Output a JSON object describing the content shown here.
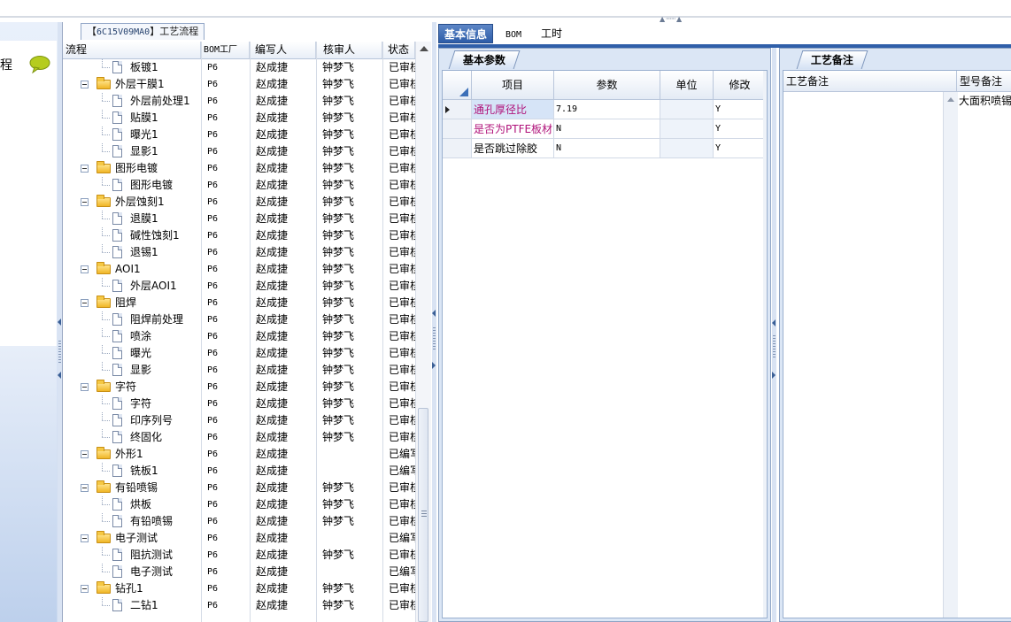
{
  "sidebar": {
    "title_fragment": "程"
  },
  "tree_panel": {
    "tab_prefix": "【",
    "tab_code": "6C15V09MA0",
    "tab_suffix": "】工艺流程",
    "columns": [
      "流程",
      "BOM工厂",
      "编写人",
      "核审人",
      "状态"
    ],
    "rows": [
      {
        "level": 2,
        "type": "doc",
        "name": "板镀1",
        "factory": "P6",
        "author": "赵成捷",
        "reviewer": "钟梦飞",
        "status": "已审核"
      },
      {
        "level": 1,
        "type": "folder",
        "name": "外层干膜1",
        "factory": "P6",
        "author": "赵成捷",
        "reviewer": "钟梦飞",
        "status": "已审核"
      },
      {
        "level": 2,
        "type": "doc",
        "name": "外层前处理1",
        "factory": "P6",
        "author": "赵成捷",
        "reviewer": "钟梦飞",
        "status": "已审核"
      },
      {
        "level": 2,
        "type": "doc",
        "name": "贴膜1",
        "factory": "P6",
        "author": "赵成捷",
        "reviewer": "钟梦飞",
        "status": "已审核"
      },
      {
        "level": 2,
        "type": "doc",
        "name": "曝光1",
        "factory": "P6",
        "author": "赵成捷",
        "reviewer": "钟梦飞",
        "status": "已审核"
      },
      {
        "level": 2,
        "type": "doc",
        "name": "显影1",
        "factory": "P6",
        "author": "赵成捷",
        "reviewer": "钟梦飞",
        "status": "已审核"
      },
      {
        "level": 1,
        "type": "folder",
        "name": "图形电镀",
        "factory": "P6",
        "author": "赵成捷",
        "reviewer": "钟梦飞",
        "status": "已审核"
      },
      {
        "level": 2,
        "type": "doc",
        "name": "图形电镀",
        "factory": "P6",
        "author": "赵成捷",
        "reviewer": "钟梦飞",
        "status": "已审核"
      },
      {
        "level": 1,
        "type": "folder",
        "name": "外层蚀刻1",
        "factory": "P6",
        "author": "赵成捷",
        "reviewer": "钟梦飞",
        "status": "已审核"
      },
      {
        "level": 2,
        "type": "doc",
        "name": "退膜1",
        "factory": "P6",
        "author": "赵成捷",
        "reviewer": "钟梦飞",
        "status": "已审核"
      },
      {
        "level": 2,
        "type": "doc",
        "name": "碱性蚀刻1",
        "factory": "P6",
        "author": "赵成捷",
        "reviewer": "钟梦飞",
        "status": "已审核"
      },
      {
        "level": 2,
        "type": "doc",
        "name": "退锡1",
        "factory": "P6",
        "author": "赵成捷",
        "reviewer": "钟梦飞",
        "status": "已审核"
      },
      {
        "level": 1,
        "type": "folder",
        "name": "AOI1",
        "factory": "P6",
        "author": "赵成捷",
        "reviewer": "钟梦飞",
        "status": "已审核"
      },
      {
        "level": 2,
        "type": "doc",
        "name": "外层AOI1",
        "factory": "P6",
        "author": "赵成捷",
        "reviewer": "钟梦飞",
        "status": "已审核"
      },
      {
        "level": 1,
        "type": "folder",
        "name": "阻焊",
        "factory": "P6",
        "author": "赵成捷",
        "reviewer": "钟梦飞",
        "status": "已审核"
      },
      {
        "level": 2,
        "type": "doc",
        "name": "阻焊前处理",
        "factory": "P6",
        "author": "赵成捷",
        "reviewer": "钟梦飞",
        "status": "已审核"
      },
      {
        "level": 2,
        "type": "doc",
        "name": "喷涂",
        "factory": "P6",
        "author": "赵成捷",
        "reviewer": "钟梦飞",
        "status": "已审核"
      },
      {
        "level": 2,
        "type": "doc",
        "name": "曝光",
        "factory": "P6",
        "author": "赵成捷",
        "reviewer": "钟梦飞",
        "status": "已审核"
      },
      {
        "level": 2,
        "type": "doc",
        "name": "显影",
        "factory": "P6",
        "author": "赵成捷",
        "reviewer": "钟梦飞",
        "status": "已审核"
      },
      {
        "level": 1,
        "type": "folder",
        "name": "字符",
        "factory": "P6",
        "author": "赵成捷",
        "reviewer": "钟梦飞",
        "status": "已审核"
      },
      {
        "level": 2,
        "type": "doc",
        "name": "字符",
        "factory": "P6",
        "author": "赵成捷",
        "reviewer": "钟梦飞",
        "status": "已审核"
      },
      {
        "level": 2,
        "type": "doc",
        "name": "印序列号",
        "factory": "P6",
        "author": "赵成捷",
        "reviewer": "钟梦飞",
        "status": "已审核"
      },
      {
        "level": 2,
        "type": "doc",
        "name": "终固化",
        "factory": "P6",
        "author": "赵成捷",
        "reviewer": "钟梦飞",
        "status": "已审核"
      },
      {
        "level": 1,
        "type": "folder",
        "name": "外形1",
        "factory": "P6",
        "author": "赵成捷",
        "reviewer": "",
        "status": "已编写"
      },
      {
        "level": 2,
        "type": "doc",
        "name": "铣板1",
        "factory": "P6",
        "author": "赵成捷",
        "reviewer": "",
        "status": "已编写"
      },
      {
        "level": 1,
        "type": "folder",
        "name": "有铅喷锡",
        "factory": "P6",
        "author": "赵成捷",
        "reviewer": "钟梦飞",
        "status": "已审核"
      },
      {
        "level": 2,
        "type": "doc",
        "name": "烘板",
        "factory": "P6",
        "author": "赵成捷",
        "reviewer": "钟梦飞",
        "status": "已审核"
      },
      {
        "level": 2,
        "type": "doc",
        "name": "有铅喷锡",
        "factory": "P6",
        "author": "赵成捷",
        "reviewer": "钟梦飞",
        "status": "已审核"
      },
      {
        "level": 1,
        "type": "folder",
        "name": "电子测试",
        "factory": "P6",
        "author": "赵成捷",
        "reviewer": "",
        "status": "已编写"
      },
      {
        "level": 2,
        "type": "doc",
        "name": "阻抗测试",
        "factory": "P6",
        "author": "赵成捷",
        "reviewer": "钟梦飞",
        "status": "已审核"
      },
      {
        "level": 2,
        "type": "doc",
        "name": "电子测试",
        "factory": "P6",
        "author": "赵成捷",
        "reviewer": "",
        "status": "已编写"
      },
      {
        "level": 1,
        "type": "folder",
        "name": "钻孔1",
        "factory": "P6",
        "author": "赵成捷",
        "reviewer": "钟梦飞",
        "status": "已审核"
      },
      {
        "level": 2,
        "type": "doc",
        "name": "二钻1",
        "factory": "P6",
        "author": "赵成捷",
        "reviewer": "钟梦飞",
        "status": "已审核"
      }
    ]
  },
  "right": {
    "tabs": [
      "基本信息",
      "BOM",
      "工时"
    ],
    "params": {
      "subtab": "基本参数",
      "columns": [
        "项目",
        "参数",
        "单位",
        "修改"
      ],
      "rows": [
        {
          "item": "通孔厚径比",
          "value": "7.19",
          "unit": "",
          "modify": "Y",
          "item_color": "#b0127a"
        },
        {
          "item": "是否为PTFE板材",
          "value": "N",
          "unit": "",
          "modify": "Y",
          "item_color": "#b0127a"
        },
        {
          "item": "是否跳过除胶",
          "value": "N",
          "unit": "",
          "modify": "Y",
          "item_color": "#000000"
        }
      ]
    },
    "notes": {
      "subtab": "工艺备注",
      "columns": [
        "工艺备注",
        "型号备注"
      ],
      "model_note": "大面积喷锡,"
    }
  },
  "colors": {
    "accent": "#2f5fa9",
    "selected_cell": "#d6e4f7",
    "highlight_text": "#b0127a"
  }
}
